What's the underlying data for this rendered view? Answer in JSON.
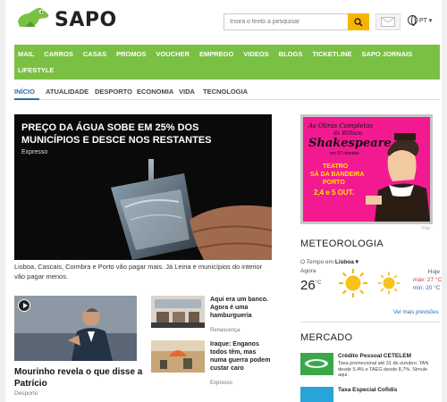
{
  "header": {
    "brand": "SAPO",
    "search_placeholder": "Insira o texto a pesquisar",
    "lang": "PT ▾"
  },
  "nav": {
    "row1": [
      "MAIL",
      "CARROS",
      "CASAS",
      "PROMOS",
      "VOUCHER",
      "EMPREGO",
      "VIDEOS",
      "BLOGS",
      "TICKETLINE",
      "SAPO JORNAIS"
    ],
    "row2": [
      "LIFESTYLE"
    ]
  },
  "subnav": [
    "INÍCIO",
    "ATUALIDADE",
    "DESPORTO",
    "ECONOMIA",
    "VIDA",
    "TECNOLOGIA"
  ],
  "hero": {
    "title": "PREÇO DA ÁGUA SOBE EM 25% DOS MUNICÍPIOS E DESCE NOS RESTANTES",
    "source": "Expresso",
    "caption": "Lisboa, Cascais, Coimbra e Porto vão pagar mais. Já Leiria e municípios do interior vão pagar menos."
  },
  "story": {
    "title": "Mourinho revela o que disse a Patrício",
    "source": "Desporto"
  },
  "mini_stories": [
    {
      "title": "Aqui era um banco. Agora é uma hamburgueria",
      "source": "Renascença"
    },
    {
      "title": "Iraque: Enganos todos têm, mas numa guerra podem custar caro",
      "source": "Expresso"
    }
  ],
  "ad": {
    "line1": "As Obras Completas",
    "line2": "de William",
    "line3": "Shakespeare",
    "line4": "em 97 minutos",
    "line5": "TEATRO",
    "line6": "SÁ DA BANDEIRA",
    "line7": "PORTO",
    "line8": "2,4 e 5 OUT.",
    "label": "Pub"
  },
  "weather": {
    "title": "METEOROLOGIA",
    "prefix": "O Tempo em",
    "location": "Lisboa ▾",
    "now_label": "Agora",
    "now_temp": "26",
    "unit": "°C",
    "today_label": "Hoje",
    "max": "máx: 27 °C",
    "min": "min: 20 °C",
    "more": "Ver mais previsões"
  },
  "market": {
    "title": "MERCADO",
    "items": [
      {
        "title": "Crédito Pessoal CETELEM",
        "desc": "Taxa promocional até 31 de outubro. TAN desde 5,4% e TAEG desde 8,7%. Simule aqui."
      },
      {
        "title": "Taxa Especial Cofidis",
        "desc": ""
      }
    ]
  },
  "colors": {
    "brand_green": "#7ac143",
    "accent_blue": "#2b6db3",
    "search_yellow": "#f7b500",
    "ad_pink": "#f31a91"
  }
}
